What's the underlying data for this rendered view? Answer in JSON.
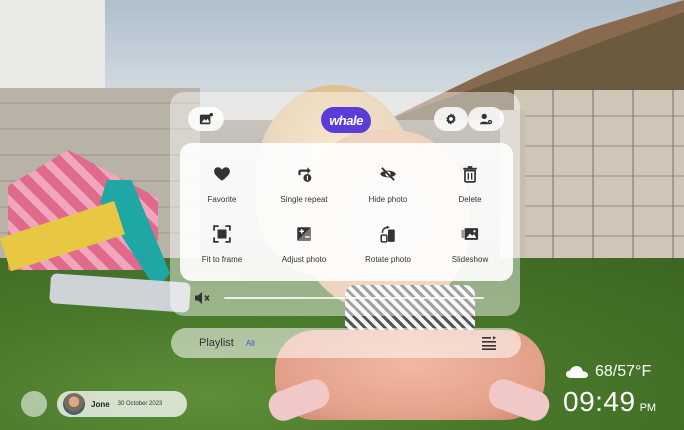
{
  "header": {
    "logo_text": "whale",
    "logo_color": "#5a3dd8"
  },
  "menu": {
    "items": [
      {
        "label": "Favorite",
        "icon": "heart-icon"
      },
      {
        "label": "Single repeat",
        "icon": "repeat-one-icon"
      },
      {
        "label": "Hide photo",
        "icon": "eye-hidden-icon"
      },
      {
        "label": "Delete",
        "icon": "trash-icon"
      },
      {
        "label": "Fit to frame",
        "icon": "fit-frame-icon"
      },
      {
        "label": "Adjust photo",
        "icon": "adjust-icon"
      },
      {
        "label": "Rotate photo",
        "icon": "rotate-icon"
      },
      {
        "label": "Slideshow",
        "icon": "slideshow-icon"
      }
    ]
  },
  "volume": {
    "muted": true,
    "icon": "volume-mute-icon"
  },
  "playlist": {
    "label": "Playlist",
    "value": "All",
    "value_color": "#3b5bd8"
  },
  "user": {
    "name": "Jone",
    "date": "30 October 2023"
  },
  "weather": {
    "temperature": "68/57°F",
    "icon": "cloud-icon"
  },
  "clock": {
    "time": "09:49",
    "ampm": "PM"
  }
}
